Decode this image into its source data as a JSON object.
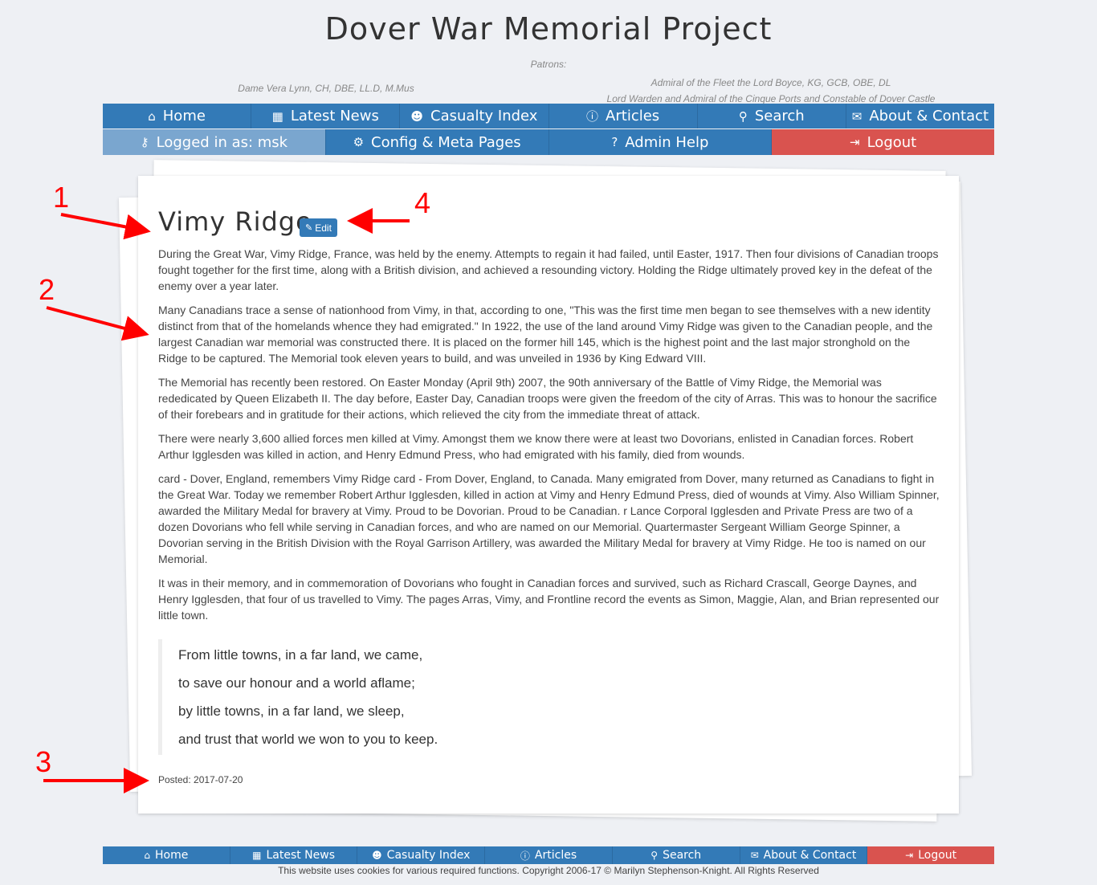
{
  "site": {
    "title": "Dover War Memorial Project",
    "patrons_label": "Patrons:",
    "patron_left": "Dame Vera Lynn, CH, DBE, LL.D, M.Mus",
    "patron_right_1": "Admiral of the Fleet the Lord Boyce, KG, GCB, OBE, DL",
    "patron_right_2": "Lord Warden and Admiral of the Cinque Ports and Constable of Dover Castle"
  },
  "nav_main": [
    {
      "label": "Home",
      "icon": "home-icon",
      "glyph": "⌂"
    },
    {
      "label": "Latest News",
      "icon": "calendar-icon",
      "glyph": "▦"
    },
    {
      "label": "Casualty Index",
      "icon": "users-icon",
      "glyph": "☻"
    },
    {
      "label": "Articles",
      "icon": "info-icon",
      "glyph": "ⓘ"
    },
    {
      "label": "Search",
      "icon": "search-icon",
      "glyph": "⚲"
    },
    {
      "label": "About & Contact",
      "icon": "envelope-icon",
      "glyph": "✉"
    }
  ],
  "nav_admin": [
    {
      "label": "Logged in as: msk",
      "icon": "key-icon",
      "glyph": "⚷"
    },
    {
      "label": "Config & Meta Pages",
      "icon": "cogs-icon",
      "glyph": "⚙"
    },
    {
      "label": "Admin Help",
      "icon": "question-icon",
      "glyph": "?"
    },
    {
      "label": "Logout",
      "icon": "logout-icon",
      "glyph": "⇥"
    }
  ],
  "article": {
    "title": "Vimy Ridge",
    "edit_label": "Edit",
    "paragraphs": [
      "During the Great War, Vimy Ridge, France, was held by the enemy. Attempts to regain it had failed, until Easter, 1917. Then four divisions of Canadian troops fought together for the first time, along with a British division, and achieved a resounding victory. Holding the Ridge ultimately proved key in the defeat of the enemy over a year later.",
      "Many Canadians trace a sense of nationhood from Vimy, in that, according to one, \"This was the first time men began to see themselves with a new identity distinct from that of the homelands whence they had emigrated.\" In 1922, the use of the land around Vimy Ridge was given to the Canadian people, and the largest Canadian war memorial was constructed there. It is placed on the former hill 145, which is the highest point and the last major stronghold on the Ridge to be captured. The Memorial took eleven years to build, and was unveiled in 1936 by King Edward VIII.",
      "The Memorial has recently been restored. On Easter Monday (April 9th) 2007, the 90th anniversary of the Battle of Vimy Ridge, the Memorial was rededicated by Queen Elizabeth II. The day before, Easter Day, Canadian troops were given the freedom of the city of Arras. This was to honour the sacrifice of their forebears and in gratitude for their actions, which relieved the city from the immediate threat of attack.",
      "There were nearly 3,600 allied forces men killed at Vimy. Amongst them we know there were at least two Dovorians, enlisted in Canadian forces. Robert Arthur Igglesden was killed in action, and Henry Edmund Press, who had emigrated with his family, died from wounds.",
      "card - Dover, England, remembers Vimy Ridge card - From Dover, England, to Canada. Many emigrated from Dover, many returned as Canadians to fight in the Great War. Today we remember Robert Arthur Igglesden, killed in action at Vimy and Henry Edmund Press, died of wounds at Vimy. Also William Spinner, awarded the Military Medal for bravery at Vimy. Proud to be Dovorian. Proud to be Canadian. r Lance Corporal Igglesden and Private Press are two of a dozen Dovorians who fell while serving in Canadian forces, and who are named on our Memorial. Quartermaster Sergeant William George Spinner, a Dovorian serving in the British Division with the Royal Garrison Artillery, was awarded the Military Medal for bravery at Vimy Ridge. He too is named on our Memorial.",
      "It was in their memory, and in commemoration of Dovorians who fought in Canadian forces and survived, such as Richard Crascall, George Daynes, and Henry Igglesden, that four of us travelled to Vimy. The pages Arras, Vimy, and Frontline record the events as Simon, Maggie, Alan, and Brian represented our little town."
    ],
    "quote": [
      "From little towns, in a far land, we came,",
      "to save our honour and a world aflame;",
      "by little towns, in a far land, we sleep,",
      "and trust that world we won to you to keep."
    ],
    "posted": "Posted: 2017-07-20"
  },
  "footer_nav": [
    {
      "label": "Home",
      "icon": "home-icon",
      "glyph": "⌂"
    },
    {
      "label": "Latest News",
      "icon": "calendar-icon",
      "glyph": "▦"
    },
    {
      "label": "Casualty Index",
      "icon": "users-icon",
      "glyph": "☻"
    },
    {
      "label": "Articles",
      "icon": "info-icon",
      "glyph": "ⓘ"
    },
    {
      "label": "Search",
      "icon": "search-icon",
      "glyph": "⚲"
    },
    {
      "label": "About & Contact",
      "icon": "envelope-icon",
      "glyph": "✉"
    },
    {
      "label": "Logout",
      "icon": "logout-icon",
      "glyph": "⇥"
    }
  ],
  "copyright": "This website uses cookies for various required functions. Copyright 2006-17 © Marilyn Stephenson-Knight. All Rights Reserved",
  "annotations": {
    "n1": "1",
    "n2": "2",
    "n3": "3",
    "n4": "4",
    "color": "#ff0000"
  },
  "colors": {
    "nav_blue": "#337ab7",
    "logged_blue": "#7aa6cf",
    "danger_red": "#d9534f",
    "page_bg": "#eef0f4"
  }
}
